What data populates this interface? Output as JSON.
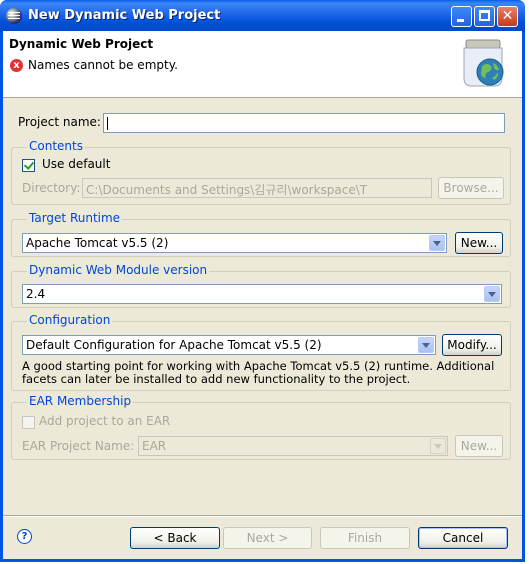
{
  "window": {
    "title": "New Dynamic Web Project"
  },
  "header": {
    "title": "Dynamic Web Project",
    "message": "Names cannot be empty."
  },
  "project_name": {
    "label": "Project name:",
    "value": ""
  },
  "contents": {
    "group_label": "Contents",
    "use_default_label": "Use default",
    "use_default_checked": true,
    "directory_label": "Directory:",
    "directory_value": "C:\\Documents and Settings\\김규리\\workspace\\T",
    "browse_label": "Browse..."
  },
  "target_runtime": {
    "group_label": "Target Runtime",
    "selected": "Apache Tomcat v5.5 (2)",
    "new_label": "New..."
  },
  "module_version": {
    "group_label": "Dynamic Web Module version",
    "selected": "2.4"
  },
  "configuration": {
    "group_label": "Configuration",
    "selected": "Default Configuration for Apache Tomcat v5.5 (2)",
    "modify_label": "Modify...",
    "description_line1": "A good starting point for working with Apache Tomcat v5.5 (2) runtime. Additional",
    "description_line2": "facets can later be installed to add new functionality to the project."
  },
  "ear": {
    "group_label": "EAR Membership",
    "add_label": "Add project to an EAR",
    "add_checked": false,
    "project_name_label": "EAR Project Name:",
    "project_name_value": "EAR",
    "new_label": "New..."
  },
  "footer": {
    "back_label": "< Back",
    "next_label": "Next >",
    "finish_label": "Finish",
    "cancel_label": "Cancel"
  },
  "colors": {
    "titlebar": "#0054e3",
    "dialog_bg": "#ece9d8",
    "group_title": "#0046d5",
    "error": "#dd3333"
  },
  "icons": {
    "app": "eclipse-icon",
    "error": "error-icon",
    "banner": "web-project-wizard-icon",
    "help": "help-icon"
  }
}
